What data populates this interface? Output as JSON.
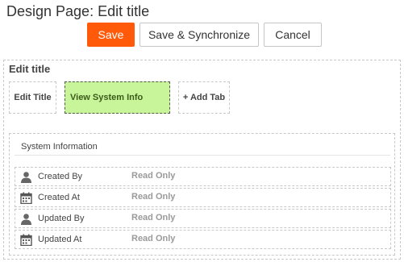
{
  "page": {
    "title": "Design Page: Edit title"
  },
  "toolbar": {
    "save_label": "Save",
    "sync_label": "Save & Synchronize",
    "cancel_label": "Cancel"
  },
  "section": {
    "title": "Edit title"
  },
  "tabs": [
    {
      "label": "Edit Title"
    },
    {
      "label": "View System Info"
    },
    {
      "label": "+ Add Tab"
    }
  ],
  "panel": {
    "title": "System Information",
    "rows": [
      {
        "label": "Created By",
        "value": "Read Only",
        "icon": "user-icon"
      },
      {
        "label": "Created At",
        "value": "Read Only",
        "icon": "calendar-icon"
      },
      {
        "label": "Updated By",
        "value": "Read Only",
        "icon": "user-icon"
      },
      {
        "label": "Updated At",
        "value": "Read Only",
        "icon": "calendar-icon"
      }
    ]
  },
  "colors": {
    "save": "#ff5a0a",
    "active_tab": "#c9f59a",
    "readonly_text": "#9a9a9a"
  }
}
